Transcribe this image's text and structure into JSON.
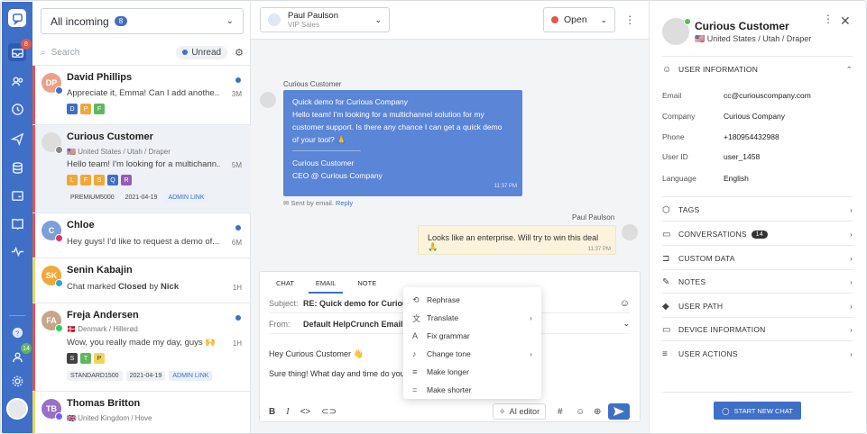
{
  "rail": {
    "inbox_badge": "8",
    "contacts_badge": "14"
  },
  "list": {
    "filter_label": "All incoming",
    "filter_count": "8",
    "search_placeholder": "Search",
    "unread_label": "Unread",
    "items": [
      {
        "name": "David Phillips",
        "initials": "DP",
        "message": "Appreciate it, Emma! Can I add anothe...",
        "time": "3M",
        "tags": [
          "D",
          "P",
          "F"
        ]
      },
      {
        "name": "Curious Customer",
        "location": "United States / Utah / Draper",
        "message": "Hello team! I'm looking for a multichann...",
        "time": "5M",
        "tags": [
          "L",
          "F",
          "S",
          "Q",
          "R"
        ],
        "chips": [
          "PREMIUM5000",
          "2021-04-19",
          "ADMIN LINK"
        ]
      },
      {
        "name": "Chloe",
        "initials": "C",
        "message": "Hey guys! I'd like to request a demo of...",
        "time": "6M"
      },
      {
        "name": "Senin Kabajin",
        "initials": "SK",
        "message_prefix": "Chat marked ",
        "message_bold1": "Closed",
        "message_mid": " by ",
        "message_bold2": "Nick",
        "time": "1H"
      },
      {
        "name": "Freja Andersen",
        "initials": "FA",
        "location": "Denmark / Hillerød",
        "message": "Wow, you really made my day, guys 🙌",
        "time": "1H",
        "tags": [
          "S",
          "T",
          "P"
        ],
        "chips": [
          "STANDARD1500",
          "2021-04-19",
          "ADMIN LINK"
        ]
      },
      {
        "name": "Thomas Britton",
        "initials": "TB",
        "location": "United Kingdom / Hove"
      }
    ]
  },
  "chat": {
    "agent_name": "Paul Paulson",
    "agent_role": "VIP Sales",
    "status": "Open",
    "customer_label": "Curious Customer",
    "bubble_lines": [
      "Quick demo for Curious Company",
      "Hello team! I'm looking for a multichannel solution for my",
      "customer support. Is there any chance I can get a quick demo",
      "of your tool? 🙏",
      "--------------------------------------",
      "Curious Customer",
      "CEO @ Curious Company"
    ],
    "bubble_time": "11:37 PM",
    "sent_by": "Sent by email.",
    "reply_link": "Reply",
    "agent_label": "Paul Paulson",
    "agent_reply": "Looks like an enterprise. Will try to win this deal 🙏",
    "agent_reply_time": "11:37 PM",
    "composer": {
      "tabs": [
        "CHAT",
        "EMAIL",
        "NOTE"
      ],
      "subject_label": "Subject:",
      "subject_value": "RE: Quick demo for Curious",
      "from_label": "From:",
      "from_value": "Default HelpCrunch Email A",
      "body1": "Hey Curious Customer 👋",
      "body2": "Sure thing! What day and time do you",
      "ai_editor": "AI editor"
    },
    "ai_menu": [
      "Rephrase",
      "Translate",
      "Fix grammar",
      "Change tone",
      "Make longer",
      "Make shorter"
    ]
  },
  "profile": {
    "name": "Curious Customer",
    "location": "United States / Utah / Draper",
    "user_info_title": "USER INFORMATION",
    "fields": [
      {
        "k": "Email",
        "v": "cc@curiouscompany.com"
      },
      {
        "k": "Company",
        "v": "Curious Company"
      },
      {
        "k": "Phone",
        "v": "+180954432988"
      },
      {
        "k": "User ID",
        "v": "user_1458"
      },
      {
        "k": "Language",
        "v": "English"
      }
    ],
    "sections": [
      "TAGS",
      "CONVERSATIONS",
      "CUSTOM DATA",
      "NOTES",
      "USER PATH",
      "DEVICE INFORMATION",
      "USER ACTIONS"
    ],
    "conversations_count": "14",
    "start_chat": "START NEW CHAT"
  }
}
